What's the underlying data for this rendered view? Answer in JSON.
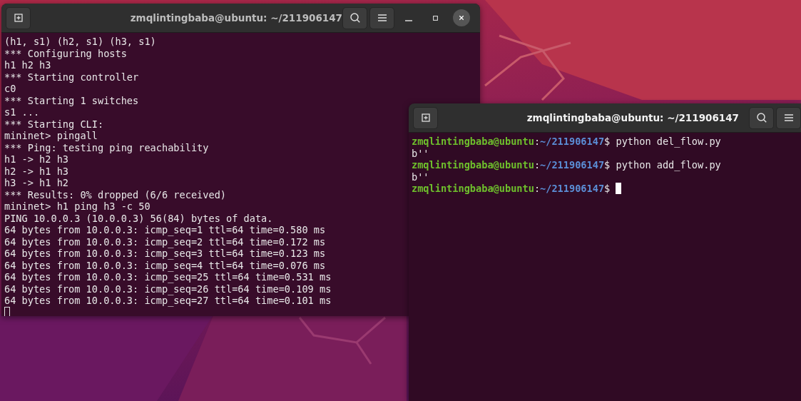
{
  "windows": [
    {
      "title": "zmqlintingbaba@ubuntu: ~/211906147",
      "focused": false,
      "controls": [
        {
          "kind": "search"
        },
        {
          "kind": "menu"
        },
        {
          "kind": "minimize"
        },
        {
          "kind": "maximize"
        },
        {
          "kind": "close"
        }
      ],
      "lines": [
        [
          {
            "kind": "text",
            "text": "(h1, s1) (h2, s1) (h3, s1)"
          }
        ],
        [
          {
            "kind": "text",
            "text": "*** Configuring hosts"
          }
        ],
        [
          {
            "kind": "text",
            "text": "h1 h2 h3"
          }
        ],
        [
          {
            "kind": "text",
            "text": "*** Starting controller"
          }
        ],
        [
          {
            "kind": "text",
            "text": "c0"
          }
        ],
        [
          {
            "kind": "text",
            "text": "*** Starting 1 switches"
          }
        ],
        [
          {
            "kind": "text",
            "text": "s1 ..."
          }
        ],
        [
          {
            "kind": "text",
            "text": "*** Starting CLI:"
          }
        ],
        [
          {
            "kind": "text",
            "text": "mininet> pingall"
          }
        ],
        [
          {
            "kind": "text",
            "text": "*** Ping: testing ping reachability"
          }
        ],
        [
          {
            "kind": "text",
            "text": "h1 -> h2 h3"
          }
        ],
        [
          {
            "kind": "text",
            "text": "h2 -> h1 h3"
          }
        ],
        [
          {
            "kind": "text",
            "text": "h3 -> h1 h2"
          }
        ],
        [
          {
            "kind": "text",
            "text": "*** Results: 0% dropped (6/6 received)"
          }
        ],
        [
          {
            "kind": "text",
            "text": "mininet> h1 ping h3 -c 50"
          }
        ],
        [
          {
            "kind": "text",
            "text": "PING 10.0.0.3 (10.0.0.3) 56(84) bytes of data."
          }
        ],
        [
          {
            "kind": "text",
            "text": "64 bytes from 10.0.0.3: icmp_seq=1 ttl=64 time=0.580 ms"
          }
        ],
        [
          {
            "kind": "text",
            "text": "64 bytes from 10.0.0.3: icmp_seq=2 ttl=64 time=0.172 ms"
          }
        ],
        [
          {
            "kind": "text",
            "text": "64 bytes from 10.0.0.3: icmp_seq=3 ttl=64 time=0.123 ms"
          }
        ],
        [
          {
            "kind": "text",
            "text": "64 bytes from 10.0.0.3: icmp_seq=4 ttl=64 time=0.076 ms"
          }
        ],
        [
          {
            "kind": "text",
            "text": "64 bytes from 10.0.0.3: icmp_seq=25 ttl=64 time=0.531 ms"
          }
        ],
        [
          {
            "kind": "text",
            "text": "64 bytes from 10.0.0.3: icmp_seq=26 ttl=64 time=0.109 ms"
          }
        ],
        [
          {
            "kind": "text",
            "text": "64 bytes from 10.0.0.3: icmp_seq=27 ttl=64 time=0.101 ms"
          }
        ],
        [
          {
            "kind": "cursor"
          }
        ]
      ]
    },
    {
      "title": "zmqlintingbaba@ubuntu: ~/211906147",
      "focused": true,
      "controls": [
        {
          "kind": "search"
        },
        {
          "kind": "menu"
        }
      ],
      "lines": [
        [
          {
            "kind": "user",
            "text": "zmqlintingbaba@ubuntu"
          },
          {
            "kind": "text",
            "text": ":"
          },
          {
            "kind": "path",
            "text": "~/211906147"
          },
          {
            "kind": "text",
            "text": "$ python del_flow.py"
          }
        ],
        [
          {
            "kind": "text",
            "text": "b''"
          }
        ],
        [
          {
            "kind": "user",
            "text": "zmqlintingbaba@ubuntu"
          },
          {
            "kind": "text",
            "text": ":"
          },
          {
            "kind": "path",
            "text": "~/211906147"
          },
          {
            "kind": "text",
            "text": "$ python add_flow.py"
          }
        ],
        [
          {
            "kind": "text",
            "text": "b''"
          }
        ],
        [
          {
            "kind": "user",
            "text": "zmqlintingbaba@ubuntu"
          },
          {
            "kind": "text",
            "text": ":"
          },
          {
            "kind": "path",
            "text": "~/211906147"
          },
          {
            "kind": "text",
            "text": "$ "
          },
          {
            "kind": "cursor"
          }
        ]
      ]
    }
  ]
}
